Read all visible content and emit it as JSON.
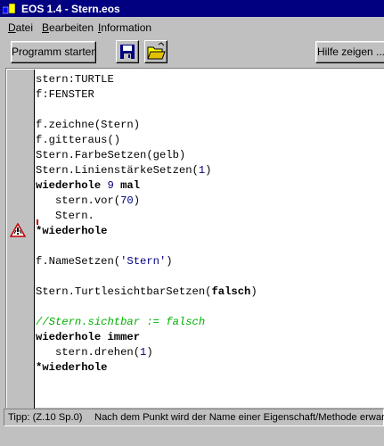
{
  "window": {
    "title": "EOS 1.4 - Stern.eos"
  },
  "menu": {
    "items": [
      {
        "first": "D",
        "rest": "atei"
      },
      {
        "first": "B",
        "rest": "earbeiten"
      },
      {
        "first": "I",
        "rest": "nformation"
      }
    ]
  },
  "toolbar": {
    "run_label": "Programm starten",
    "help_label": "Hilfe zeigen ..."
  },
  "code_lines": [
    [
      {
        "t": "stern:TURTLE",
        "c": ""
      }
    ],
    [
      {
        "t": "f:FENSTER",
        "c": ""
      }
    ],
    [],
    [
      {
        "t": "f.zeichne(Stern)",
        "c": ""
      }
    ],
    [
      {
        "t": "f.gitteraus()",
        "c": ""
      }
    ],
    [
      {
        "t": "Stern.FarbeSetzen(gelb)",
        "c": ""
      }
    ],
    [
      {
        "t": "Stern.LinienstärkeSetzen(",
        "c": ""
      },
      {
        "t": "1",
        "c": "num"
      },
      {
        "t": ")",
        "c": ""
      }
    ],
    [
      {
        "t": "wiederhole ",
        "c": "kw"
      },
      {
        "t": "9",
        "c": "num"
      },
      {
        "t": " mal",
        "c": "kw"
      }
    ],
    [
      {
        "t": "   stern.vor(",
        "c": ""
      },
      {
        "t": "70",
        "c": "num"
      },
      {
        "t": ")",
        "c": ""
      }
    ],
    [
      {
        "t": "   Stern.",
        "c": ""
      }
    ],
    [
      {
        "t": "*wiederhole",
        "c": "kw"
      }
    ],
    [],
    [
      {
        "t": "f.NameSetzen(",
        "c": ""
      },
      {
        "t": "'Stern'",
        "c": "num"
      },
      {
        "t": ")",
        "c": ""
      }
    ],
    [],
    [
      {
        "t": "Stern.TurtlesichtbarSetzen(",
        "c": ""
      },
      {
        "t": "falsch",
        "c": "kw"
      },
      {
        "t": ")",
        "c": ""
      }
    ],
    [],
    [
      {
        "t": "//Stern.sichtbar := falsch",
        "c": "cmt"
      }
    ],
    [
      {
        "t": "wiederhole immer",
        "c": "kw"
      }
    ],
    [
      {
        "t": "   stern.drehen(",
        "c": ""
      },
      {
        "t": "1",
        "c": "num"
      },
      {
        "t": ")",
        "c": ""
      }
    ],
    [
      {
        "t": "*wiederhole",
        "c": "kw"
      }
    ]
  ],
  "status": {
    "tip": "Tipp: (Z.10 Sp.0)",
    "message": "Nach dem Punkt wird der Name einer Eigenschaft/Methode erwartet."
  },
  "icons": {
    "save": "save-disk-icon",
    "open": "open-folder-icon",
    "warning": "warning-triangle-icon"
  }
}
